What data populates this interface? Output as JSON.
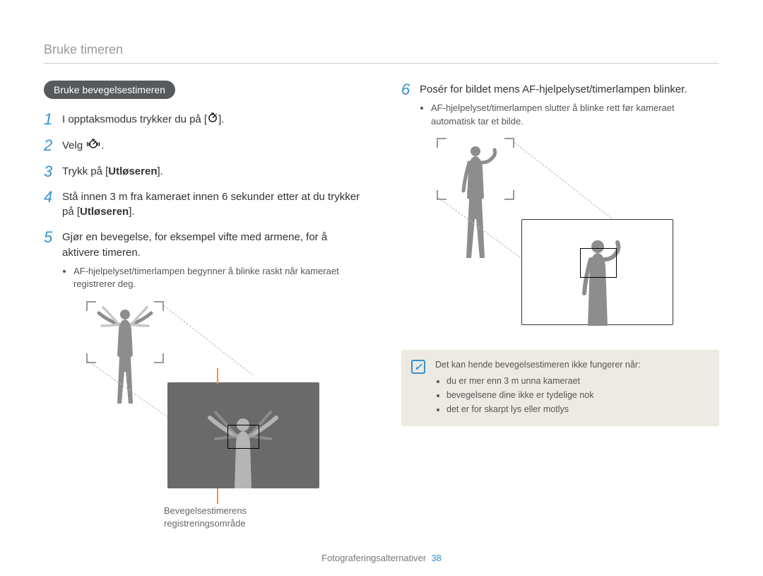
{
  "header": {
    "title": "Bruke timeren"
  },
  "section": {
    "pill": "Bruke bevegelsestimeren"
  },
  "left": {
    "step1": {
      "text_a": "I opptaksmodus trykker du på [",
      "text_b": "]."
    },
    "step2": {
      "text_a": "Velg ",
      "text_b": "."
    },
    "step3": {
      "text_a": "Trykk på [",
      "bold": "Utløseren",
      "text_b": "]."
    },
    "step4": {
      "text_a": "Stå innen 3 m fra kameraet innen 6 sekunder etter at du trykker på [",
      "bold": "Utløseren",
      "text_b": "]."
    },
    "step5": {
      "text": "Gjør en bevegelse, for eksempel vifte med armene, for å aktivere timeren.",
      "bullet": "AF-hjelpelyset/timerlampen begynner å blinke raskt når kameraet registrerer deg."
    },
    "callout": {
      "line1": "Bevegelsestimerens",
      "line2": "registreringsområde"
    }
  },
  "right": {
    "step6": {
      "text": "Posér for bildet mens AF-hjelpelyset/timerlampen blinker.",
      "bullet": "AF-hjelpelyset/timerlampen slutter å blinke rett før kameraet automatisk tar et bilde."
    },
    "note": {
      "intro": "Det kan hende bevegelsestimeren ikke fungerer når:",
      "b1": "du er mer enn 3 m unna kameraet",
      "b2": "bevegelsene dine ikke er tydelige nok",
      "b3": "det er for skarpt lys eller motlys"
    }
  },
  "footer": {
    "section": "Fotograferingsalternativer",
    "page": "38"
  },
  "numbers": {
    "n1": "1",
    "n2": "2",
    "n3": "3",
    "n4": "4",
    "n5": "5",
    "n6": "6"
  }
}
